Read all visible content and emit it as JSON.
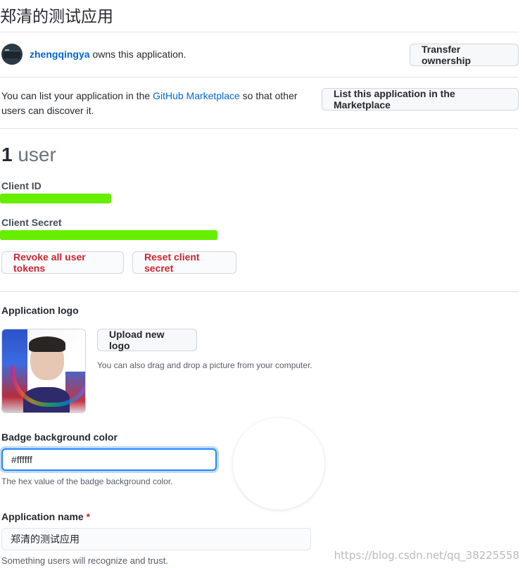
{
  "app": {
    "title": "郑清的测试应用"
  },
  "owner": {
    "username": "zhengqingya",
    "owns_text": " owns this application.",
    "transfer_button": "Transfer ownership"
  },
  "marketplace": {
    "text_before": "You can list your application in the ",
    "link": "GitHub Marketplace",
    "text_after": " so that other users can discover it.",
    "button": "List this application in the Marketplace"
  },
  "users": {
    "count": "1",
    "label": "user"
  },
  "credentials": {
    "client_id_label": "Client ID",
    "client_secret_label": "Client Secret",
    "revoke_button": "Revoke all user tokens",
    "reset_button": "Reset client secret"
  },
  "logo": {
    "label": "Application logo",
    "upload_button": "Upload new logo",
    "drag_hint": "You can also drag and drop a picture from your computer."
  },
  "badge": {
    "label": "Badge background color",
    "value": "#ffffff",
    "hint": "The hex value of the badge background color."
  },
  "app_name": {
    "label": "Application name",
    "required_marker": "*",
    "value": "郑清的测试应用",
    "hint": "Something users will recognize and trust."
  },
  "watermark": "https://blog.csdn.net/qq_38225558",
  "colors": {
    "link": "#0366d6",
    "danger": "#cb2431",
    "redaction": "#66ee00",
    "focus": "#2188ff"
  }
}
